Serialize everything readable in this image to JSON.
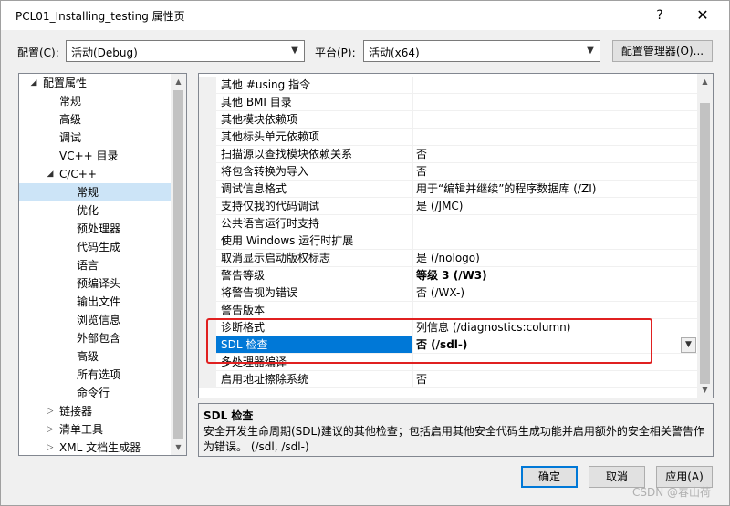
{
  "window": {
    "title": "PCL01_Installing_testing 属性页",
    "help_glyph": "?",
    "close_glyph": "✕"
  },
  "config_row": {
    "configuration_label": "配置(C):",
    "configuration_value": "活动(Debug)",
    "platform_label": "平台(P):",
    "platform_value": "活动(x64)",
    "manager_button": "配置管理器(O)..."
  },
  "tree": {
    "items": [
      {
        "label": "配置属性",
        "expander": "◢",
        "level": 0
      },
      {
        "label": "常规",
        "expander": "",
        "level": 1
      },
      {
        "label": "高级",
        "expander": "",
        "level": 1
      },
      {
        "label": "调试",
        "expander": "",
        "level": 1
      },
      {
        "label": "VC++ 目录",
        "expander": "",
        "level": 1
      },
      {
        "label": "C/C++",
        "expander": "◢",
        "level": 1
      },
      {
        "label": "常规",
        "expander": "",
        "level": 2,
        "selected": true
      },
      {
        "label": "优化",
        "expander": "",
        "level": 2
      },
      {
        "label": "预处理器",
        "expander": "",
        "level": 2
      },
      {
        "label": "代码生成",
        "expander": "",
        "level": 2
      },
      {
        "label": "语言",
        "expander": "",
        "level": 2
      },
      {
        "label": "预编译头",
        "expander": "",
        "level": 2
      },
      {
        "label": "输出文件",
        "expander": "",
        "level": 2
      },
      {
        "label": "浏览信息",
        "expander": "",
        "level": 2
      },
      {
        "label": "外部包含",
        "expander": "",
        "level": 2
      },
      {
        "label": "高级",
        "expander": "",
        "level": 2
      },
      {
        "label": "所有选项",
        "expander": "",
        "level": 2
      },
      {
        "label": "命令行",
        "expander": "",
        "level": 2
      },
      {
        "label": "链接器",
        "expander": "▷",
        "level": 1
      },
      {
        "label": "清单工具",
        "expander": "▷",
        "level": 1
      },
      {
        "label": "XML 文档生成器",
        "expander": "▷",
        "level": 1
      }
    ]
  },
  "properties": [
    {
      "name": "其他 #using 指令",
      "value": ""
    },
    {
      "name": "其他 BMI 目录",
      "value": ""
    },
    {
      "name": "其他模块依赖项",
      "value": ""
    },
    {
      "name": "其他标头单元依赖项",
      "value": ""
    },
    {
      "name": "扫描源以查找模块依赖关系",
      "value": "否"
    },
    {
      "name": "将包含转换为导入",
      "value": "否"
    },
    {
      "name": "调试信息格式",
      "value": "用于“编辑并继续”的程序数据库 (/ZI)"
    },
    {
      "name": "支持仅我的代码调试",
      "value": "是 (/JMC)"
    },
    {
      "name": "公共语言运行时支持",
      "value": ""
    },
    {
      "name": "使用 Windows 运行时扩展",
      "value": ""
    },
    {
      "name": "取消显示启动版权标志",
      "value": "是 (/nologo)"
    },
    {
      "name": "警告等级",
      "value": "等级 3 (/W3)",
      "bold": true
    },
    {
      "name": "将警告视为错误",
      "value": "否 (/WX-)"
    },
    {
      "name": "警告版本",
      "value": ""
    },
    {
      "name": "诊断格式",
      "value": "列信息 (/diagnostics:column)"
    },
    {
      "name": "SDL 检查",
      "value": "否 (/sdl-)",
      "bold": true,
      "selected": true
    },
    {
      "name": "多处理器编译",
      "value": ""
    },
    {
      "name": "启用地址擦除系统",
      "value": "否"
    }
  ],
  "description": {
    "title": "SDL 检查",
    "text": "安全开发生命周期(SDL)建议的其他检查；包括启用其他安全代码生成功能并启用额外的安全相关警告作为错误。      (/sdl, /sdl-)"
  },
  "buttons": {
    "ok": "确定",
    "cancel": "取消",
    "apply": "应用(A)"
  },
  "watermark": "CSDN @春山荷",
  "colors": {
    "selection": "#0078d7",
    "tree_selection": "#cce4f7",
    "annotation": "#e02020"
  }
}
